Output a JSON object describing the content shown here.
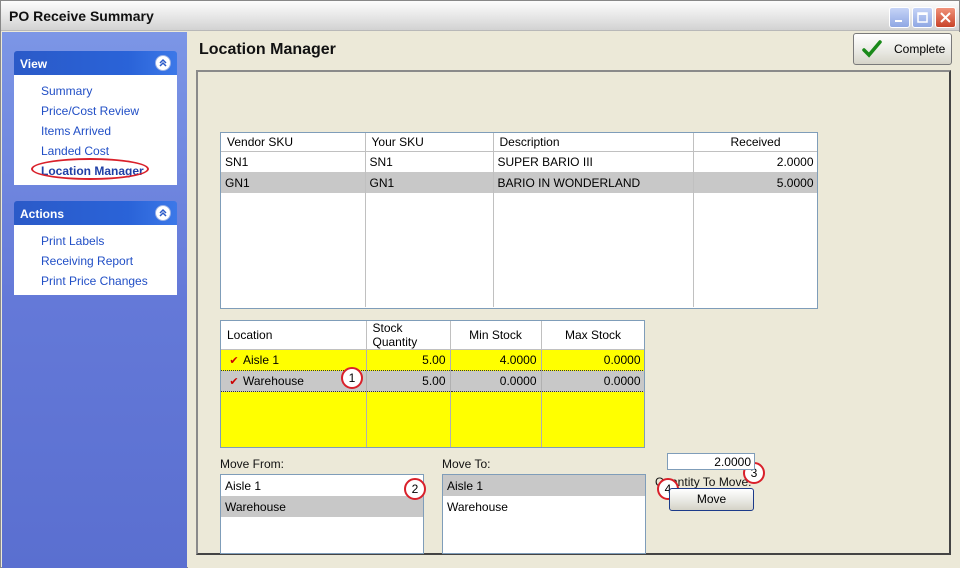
{
  "window": {
    "title": "PO Receive Summary"
  },
  "sidebar": {
    "view": {
      "heading": "View",
      "items": [
        {
          "label": "Summary"
        },
        {
          "label": "Price/Cost Review"
        },
        {
          "label": "Items Arrived"
        },
        {
          "label": "Landed Cost"
        },
        {
          "label": "Location Manager",
          "active": true
        }
      ]
    },
    "actions": {
      "heading": "Actions",
      "items": [
        {
          "label": "Print Labels"
        },
        {
          "label": "Receiving Report"
        },
        {
          "label": "Print Price Changes"
        }
      ]
    }
  },
  "main": {
    "title": "Location Manager",
    "complete_label": "Complete",
    "items_grid": {
      "columns": [
        "Vendor SKU",
        "Your SKU",
        "Description",
        "Received"
      ],
      "rows": [
        {
          "vendor_sku": "SN1",
          "your_sku": "SN1",
          "description": "SUPER BARIO III",
          "received": "2.0000"
        },
        {
          "vendor_sku": "GN1",
          "your_sku": "GN1",
          "description": "BARIO IN WONDERLAND",
          "received": "5.0000"
        }
      ]
    },
    "location_grid": {
      "columns": [
        "Location",
        "Stock Quantity",
        "Min Stock",
        "Max Stock"
      ],
      "rows": [
        {
          "location": "Aisle 1",
          "stock_quantity": "5.00",
          "min_stock": "4.0000",
          "max_stock": "0.0000"
        },
        {
          "location": "Warehouse",
          "stock_quantity": "5.00",
          "min_stock": "0.0000",
          "max_stock": "0.0000"
        }
      ]
    },
    "move_from": {
      "label": "Move From:",
      "options": [
        "Aisle 1",
        "Warehouse"
      ],
      "selected": "Warehouse"
    },
    "move_to": {
      "label": "Move To:",
      "options": [
        "Aisle 1",
        "Warehouse"
      ],
      "selected": "Aisle 1"
    },
    "quantity": {
      "label": "Quantity To Move:",
      "value": "2.0000"
    },
    "move_label": "Move",
    "callouts": [
      "1",
      "2",
      "3",
      "4"
    ]
  },
  "colors": {
    "accent_red": "#d9202a",
    "grid_yellow": "#ffff00",
    "selection_gray": "#c8c8c8"
  }
}
